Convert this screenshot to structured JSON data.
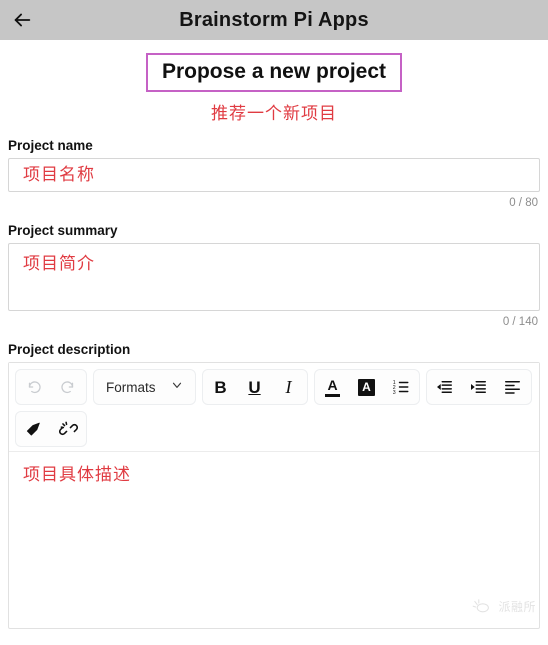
{
  "header": {
    "back_icon": "arrow-left-icon",
    "title": "Brainstorm Pi Apps"
  },
  "hero": {
    "boxed_title": "Propose a new project",
    "annotation": "推荐一个新项目",
    "box_border_color": "#c561c5",
    "annotation_color": "#e03b42"
  },
  "fields": {
    "project_name": {
      "label": "Project name",
      "value": "项目名称",
      "counter": "0 / 80"
    },
    "project_summary": {
      "label": "Project summary",
      "value": "项目简介",
      "counter": "0 / 140"
    },
    "project_description": {
      "label": "Project description",
      "value": "项目具体描述"
    }
  },
  "toolbar": {
    "undo_label": "undo-icon",
    "redo_label": "redo-icon",
    "formats_label": "Formats",
    "chevron_label": "chevron-down-icon",
    "bold_label": "B",
    "underline_label": "U",
    "italic_label": "I",
    "text_color_label": "A",
    "background_color_label": "A",
    "numbered_list_label": "numbered-list-icon",
    "outdent_label": "outdent-icon",
    "indent_label": "indent-icon",
    "align_left_label": "align-left-icon",
    "clear_format_label": "eraser-icon",
    "unlink_label": "broken-link-icon"
  },
  "watermark": {
    "text": "派融所"
  }
}
